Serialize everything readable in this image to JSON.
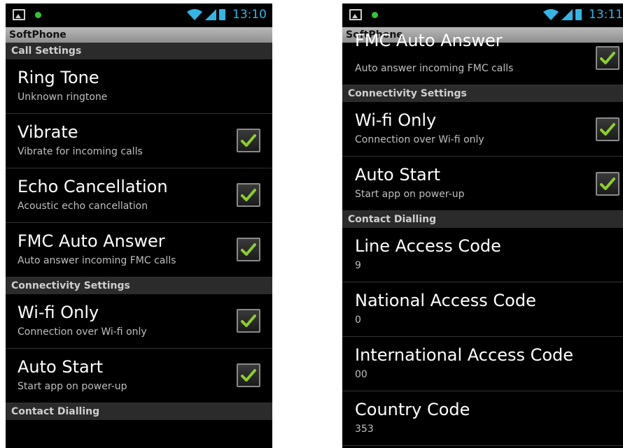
{
  "left": {
    "status": {
      "time": "13:10"
    },
    "app_title": "SoftPhone",
    "sections": [
      {
        "header": "Call Settings",
        "items": [
          {
            "title": "Ring Tone",
            "summary": "Unknown ringtone",
            "checked": null
          },
          {
            "title": "Vibrate",
            "summary": "Vibrate for incoming calls",
            "checked": true
          },
          {
            "title": "Echo Cancellation",
            "summary": "Acoustic echo cancellation",
            "checked": true
          },
          {
            "title": "FMC Auto Answer",
            "summary": "Auto answer incoming FMC calls",
            "checked": true
          }
        ]
      },
      {
        "header": "Connectivity Settings",
        "items": [
          {
            "title": "Wi-fi Only",
            "summary": "Connection over Wi-fi only",
            "checked": true
          },
          {
            "title": "Auto Start",
            "summary": "Start app on power-up",
            "checked": true
          }
        ]
      },
      {
        "header": "Contact Dialling",
        "items": []
      }
    ]
  },
  "right": {
    "status": {
      "time": "13:11"
    },
    "app_title": "SoftPhone",
    "partial_item": {
      "title": "FMC Auto Answer",
      "summary": "Auto answer incoming FMC calls",
      "checked": true
    },
    "sections": [
      {
        "header": "Connectivity Settings",
        "items": [
          {
            "title": "Wi-fi Only",
            "summary": "Connection over Wi-fi only",
            "checked": true
          },
          {
            "title": "Auto Start",
            "summary": "Start app on power-up",
            "checked": true
          }
        ]
      },
      {
        "header": "Contact Dialling",
        "items": [
          {
            "title": "Line Access Code",
            "summary": "9",
            "checked": null
          },
          {
            "title": "National Access Code",
            "summary": "0",
            "checked": null
          },
          {
            "title": "International Access Code",
            "summary": "00",
            "checked": null
          },
          {
            "title": "Country Code",
            "summary": "353",
            "checked": null
          }
        ]
      }
    ]
  },
  "colors": {
    "accent": "#33b5e5",
    "check": "#8ccf2a",
    "notification_dot": "#34c43a"
  },
  "icons": {
    "status_left": [
      "image-icon",
      "notification-dot-icon"
    ],
    "status_right": [
      "wifi-icon",
      "signal-icon",
      "battery-icon"
    ],
    "checkbox": "checkmark-icon"
  }
}
